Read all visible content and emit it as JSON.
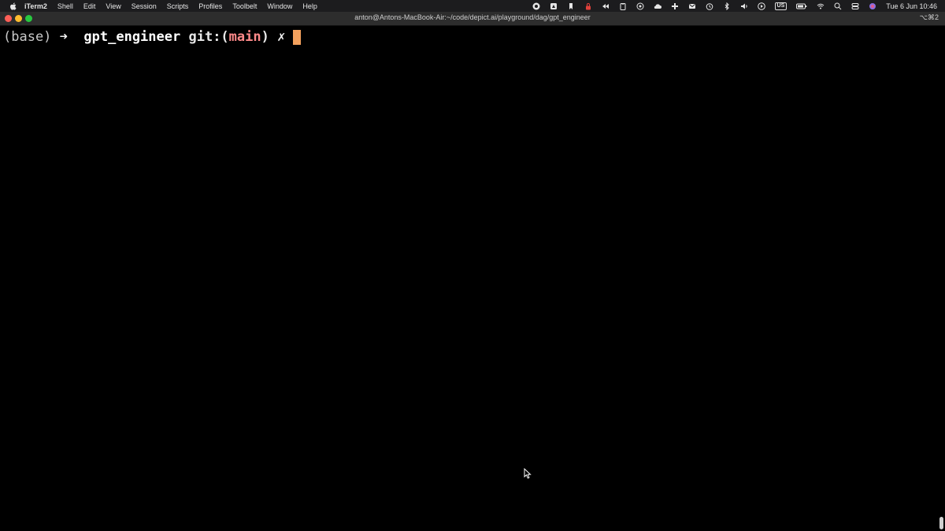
{
  "menubar": {
    "app_name": "iTerm2",
    "items": [
      "Shell",
      "Edit",
      "View",
      "Session",
      "Scripts",
      "Profiles",
      "Toolbelt",
      "Window",
      "Help"
    ],
    "input_source": "US",
    "clock": "Tue 6 Jun  10:46"
  },
  "window": {
    "title": "anton@Antons-MacBook-Air:~/code/depict.ai/playground/dag/gpt_engineer",
    "shortcut": "⌥⌘2"
  },
  "terminal": {
    "env": "(base)",
    "arrow": "➜",
    "directory": "gpt_engineer",
    "git_prefix": "git:(",
    "branch": "main",
    "git_suffix": ")",
    "dirty_marker": "✗"
  },
  "colors": {
    "cursor": "#f4a15d",
    "branch": "#ff8a8a",
    "background": "#000000"
  }
}
